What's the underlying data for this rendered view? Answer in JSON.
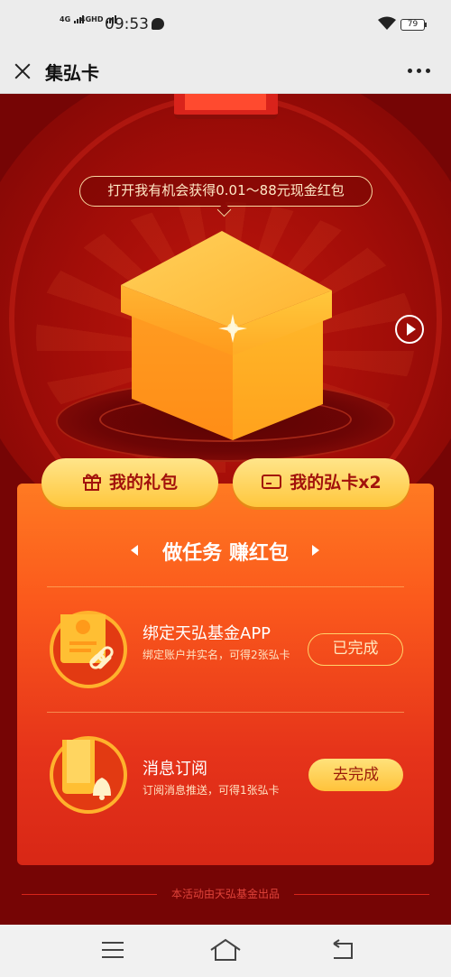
{
  "status_bar": {
    "net1": "4G",
    "net2": "4GHD",
    "time": "09:53",
    "battery": "79",
    "icons": [
      "signal-icon",
      "message-icon",
      "wifi-icon",
      "battery-icon"
    ]
  },
  "title_bar": {
    "title": "集弘卡",
    "close_icon": "close-icon",
    "more_icon": "more-icon"
  },
  "hero": {
    "bubble_text": "打开我有机会获得0.01～88元现金红包",
    "gift_box": "gift-box-illustration",
    "play_icon": "play-icon"
  },
  "buttons": {
    "my_gift": "我的礼包",
    "my_card": "我的弘卡x2"
  },
  "tasks_panel": {
    "heading": "做任务 赚红包",
    "items": [
      {
        "title": "绑定天弘基金APP",
        "desc": "绑定账户并实名，可得2张弘卡",
        "action": "已完成",
        "icon": "account-bind-icon"
      },
      {
        "title": "消息订阅",
        "desc": "订阅消息推送，可得1张弘卡",
        "action": "去完成",
        "icon": "phone-bell-icon"
      }
    ]
  },
  "footer": {
    "text": "本活动由天弘基金出品"
  },
  "colors": {
    "background": "#760505",
    "panel": "#fb5a1c",
    "gold": "#ffc73d",
    "text_dark_red": "#a2120c"
  }
}
